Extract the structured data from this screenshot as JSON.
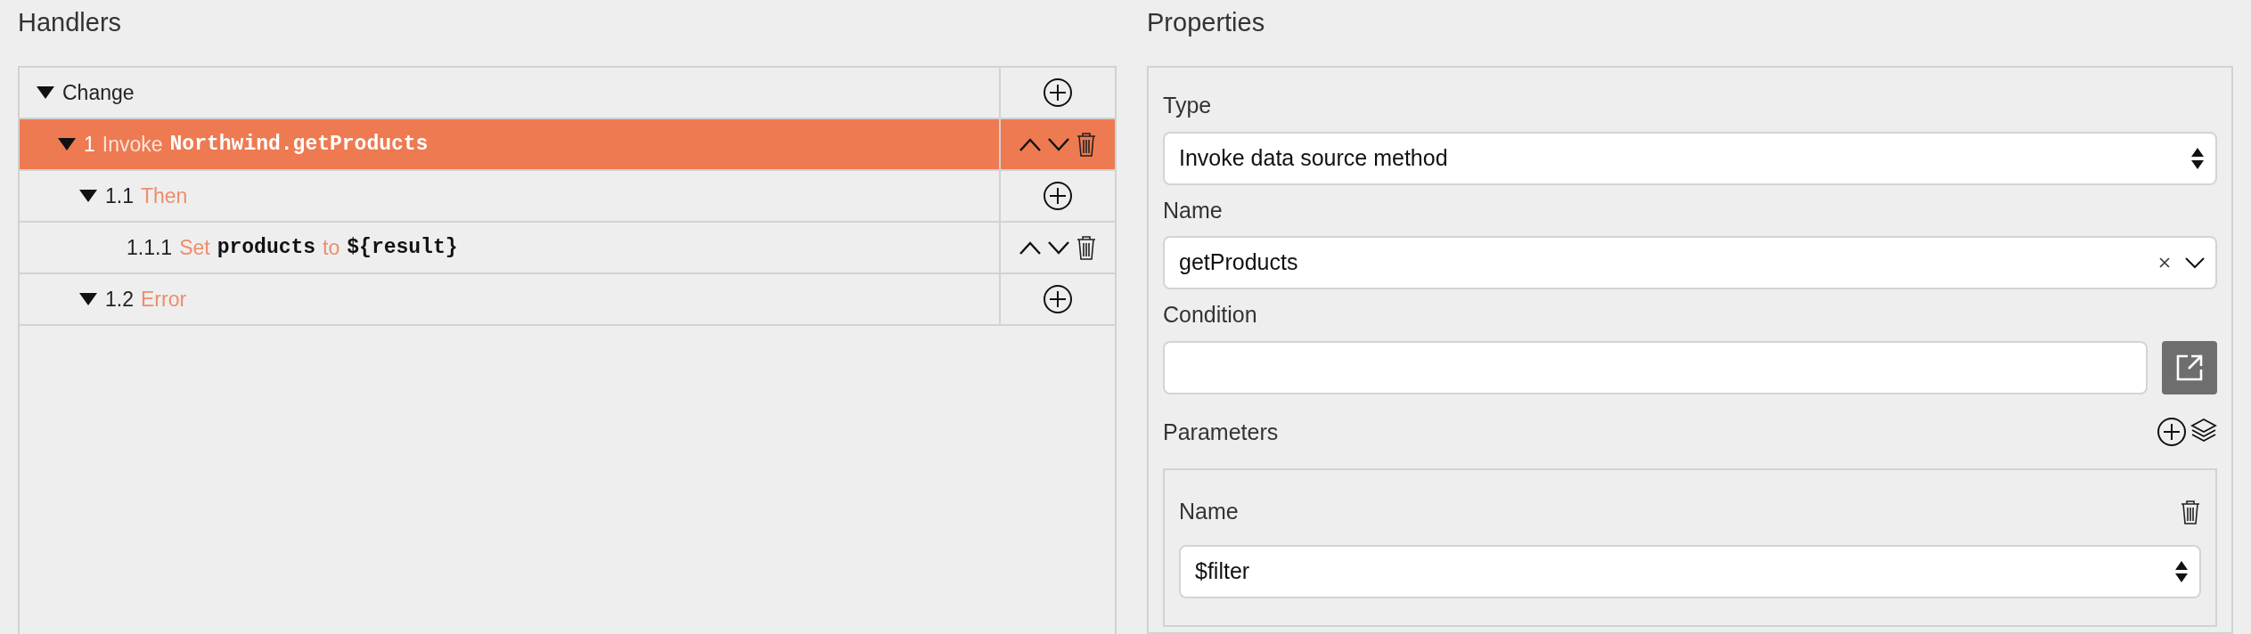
{
  "handlers": {
    "title": "Handlers",
    "tree": [
      {
        "parts": [
          {
            "kind": "label",
            "text": "Change"
          }
        ],
        "expanded": true,
        "selected": false,
        "actions": [
          {
            "kind": "add"
          }
        ],
        "children": [
          {
            "parts": [
              {
                "kind": "number",
                "text": "1"
              },
              {
                "kind": "keyword",
                "text": "Invoke"
              },
              {
                "kind": "code",
                "text": "Northwind.getProducts"
              }
            ],
            "expanded": true,
            "selected": true,
            "actions": [
              {
                "kind": "up"
              },
              {
                "kind": "down"
              },
              {
                "kind": "delete"
              }
            ],
            "children": [
              {
                "parts": [
                  {
                    "kind": "number",
                    "text": "1.1"
                  },
                  {
                    "kind": "keyword",
                    "text": "Then"
                  }
                ],
                "expanded": true,
                "selected": false,
                "actions": [
                  {
                    "kind": "add"
                  }
                ],
                "children": [
                  {
                    "parts": [
                      {
                        "kind": "number",
                        "text": "1.1.1"
                      },
                      {
                        "kind": "keyword",
                        "text": "Set"
                      },
                      {
                        "kind": "code",
                        "text": "products"
                      },
                      {
                        "kind": "keyword",
                        "text": "to"
                      },
                      {
                        "kind": "code",
                        "text": "${result}"
                      }
                    ],
                    "selected": false,
                    "actions": [
                      {
                        "kind": "up"
                      },
                      {
                        "kind": "down"
                      },
                      {
                        "kind": "delete"
                      }
                    ]
                  }
                ]
              },
              {
                "parts": [
                  {
                    "kind": "number",
                    "text": "1.2"
                  },
                  {
                    "kind": "keyword",
                    "text": "Error"
                  }
                ],
                "expanded": true,
                "selected": false,
                "actions": [
                  {
                    "kind": "add"
                  }
                ]
              }
            ]
          }
        ]
      }
    ]
  },
  "properties": {
    "title": "Properties",
    "type": {
      "label": "Type",
      "value": "Invoke data source method"
    },
    "name": {
      "label": "Name",
      "value": "getProducts"
    },
    "condition": {
      "label": "Condition"
    },
    "parameters": {
      "label": "Parameters",
      "items": [
        {
          "label": "Name",
          "value": "$filter"
        }
      ]
    }
  }
}
